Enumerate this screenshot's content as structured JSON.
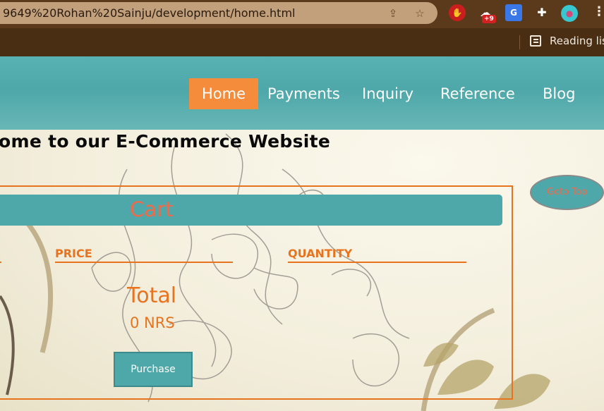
{
  "browser": {
    "url": "9649%20Rohan%20Sainju/development/home.html",
    "extension_badge": "+9",
    "reading_list_label": "Reading list",
    "icons": [
      "share-icon",
      "star-icon",
      "adblock-icon",
      "weather-icon",
      "translate-icon",
      "puzzle-icon",
      "profile-avatar",
      "kebab-menu-icon"
    ]
  },
  "nav": {
    "items": [
      {
        "label": "Home",
        "active": true
      },
      {
        "label": "Payments",
        "active": false
      },
      {
        "label": "Inquiry",
        "active": false
      },
      {
        "label": "Reference",
        "active": false
      },
      {
        "label": "Blog",
        "active": false
      }
    ]
  },
  "main": {
    "welcome": "lcome to our E-Commerce Website",
    "cart_title": "Cart",
    "columns": [
      "PRICE",
      "QUANTITY"
    ],
    "total_label": "Total",
    "total_value": "0 NRS",
    "purchase_label": "Purchase",
    "go_top_label": "Goto Top"
  },
  "colors": {
    "accent_teal": "#4ea7a9",
    "accent_orange": "#e8731e",
    "nav_active": "#f48c3c",
    "chrome_brown": "#5a3a1a"
  }
}
